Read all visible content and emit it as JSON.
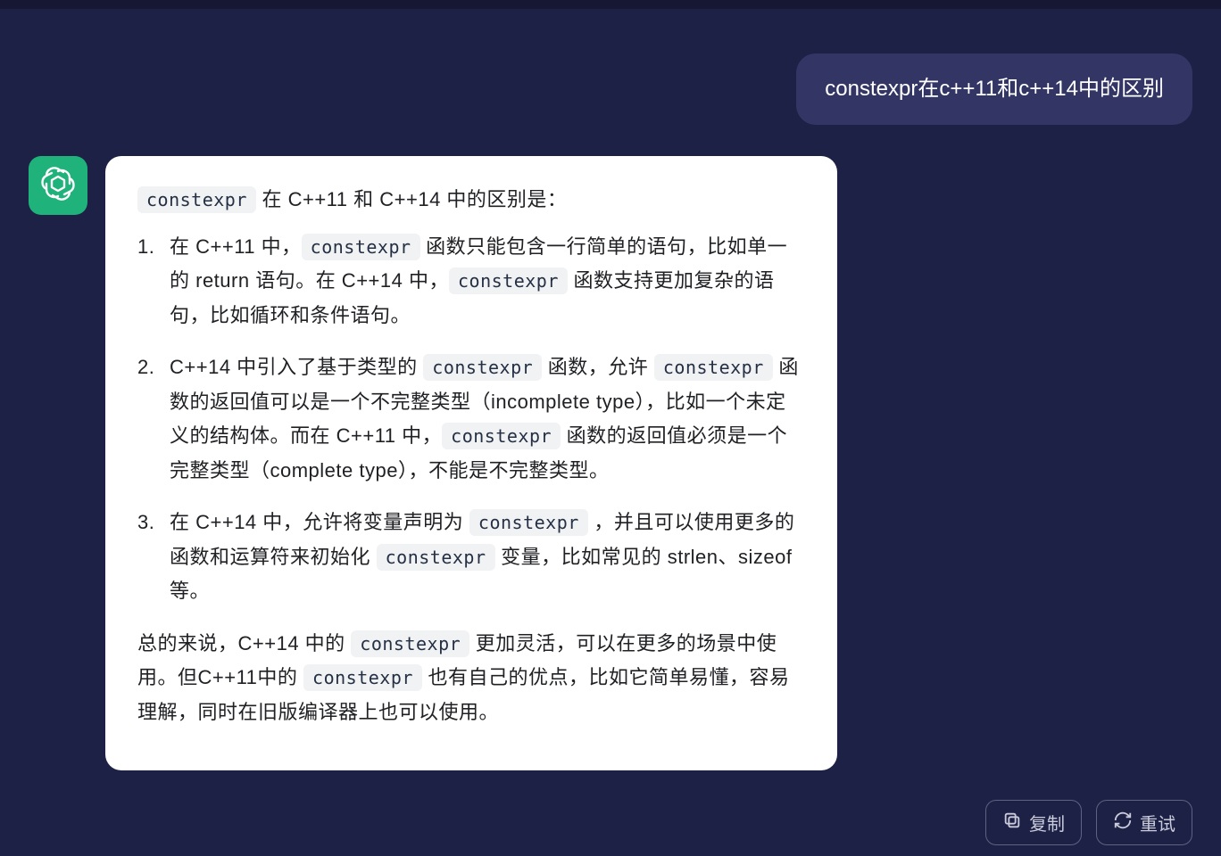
{
  "user": {
    "message": "constexpr在c++11和c++14中的区别"
  },
  "assistant": {
    "code_token": "constexpr",
    "intro_pre": "",
    "intro_post": " 在 C++11 和 C++14 中的区别是：",
    "items": [
      {
        "seg": [
          {
            "t": "在 C++11 中，"
          },
          {
            "c": "constexpr"
          },
          {
            "t": " 函数只能包含一行简单的语句，比如单一的 return 语句。在 C++14 中，"
          },
          {
            "c": "constexpr"
          },
          {
            "t": " 函数支持更加复杂的语句，比如循环和条件语句。"
          }
        ]
      },
      {
        "seg": [
          {
            "t": "C++14 中引入了基于类型的 "
          },
          {
            "c": "constexpr"
          },
          {
            "t": " 函数，允许 "
          },
          {
            "c": "constexpr"
          },
          {
            "t": " 函数的返回值可以是一个不完整类型（incomplete type），比如一个未定义的结构体。而在 C++11 中，"
          },
          {
            "c": "constexpr"
          },
          {
            "t": " 函数的返回值必须是一个完整类型（complete type），不能是不完整类型。"
          }
        ]
      },
      {
        "seg": [
          {
            "t": "在 C++14 中，允许将变量声明为 "
          },
          {
            "c": "constexpr"
          },
          {
            "t": " ，并且可以使用更多的函数和运算符来初始化 "
          },
          {
            "c": "constexpr"
          },
          {
            "t": " 变量，比如常见的 strlen、sizeof 等。"
          }
        ]
      }
    ],
    "summary_seg": [
      {
        "t": "总的来说，C++14 中的 "
      },
      {
        "c": "constexpr"
      },
      {
        "t": " 更加灵活，可以在更多的场景中使用。但C++11中的 "
      },
      {
        "c": "constexpr"
      },
      {
        "t": " 也有自己的优点，比如它简单易懂，容易理解，同时在旧版编译器上也可以使用。"
      }
    ]
  },
  "actions": {
    "copy": "复制",
    "retry": "重试"
  }
}
